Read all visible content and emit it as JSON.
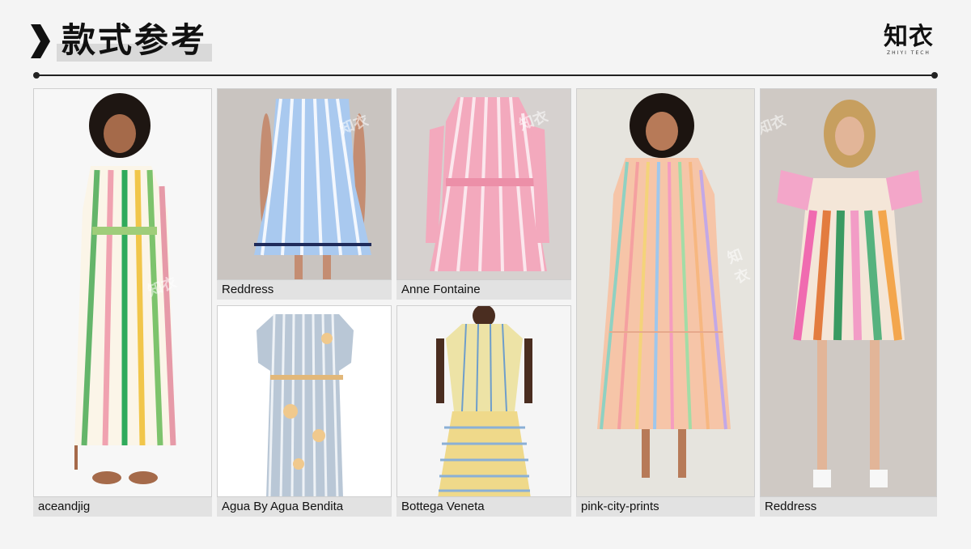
{
  "header": {
    "title": "款式参考",
    "logo_main": "知衣",
    "logo_sub": "ZHIYI TECH"
  },
  "watermark_text": "知衣",
  "cards": [
    {
      "caption": "aceandjig",
      "photo_icon": "striped-shirt-dress-model"
    },
    {
      "caption": "Reddress",
      "photo_icon": "blue-striped-dress-model"
    },
    {
      "caption": "Anne Fontaine",
      "photo_icon": "pink-striped-shirt-dress-model"
    },
    {
      "caption": "Agua By Agua Bendita",
      "photo_icon": "floral-striped-dress"
    },
    {
      "caption": "Bottega Veneta",
      "photo_icon": "yellow-striped-dress-model"
    },
    {
      "caption": "pink-city-prints",
      "photo_icon": "rainbow-striped-tiered-dress-model"
    },
    {
      "caption": "Reddress",
      "photo_icon": "multicolor-striped-babydoll-dress-model"
    }
  ],
  "colors": {
    "background": "#f4f4f4",
    "caption_bar": "#e2e2e2",
    "title_highlight": "#d9d9d9",
    "accent_dark": "#111111"
  }
}
